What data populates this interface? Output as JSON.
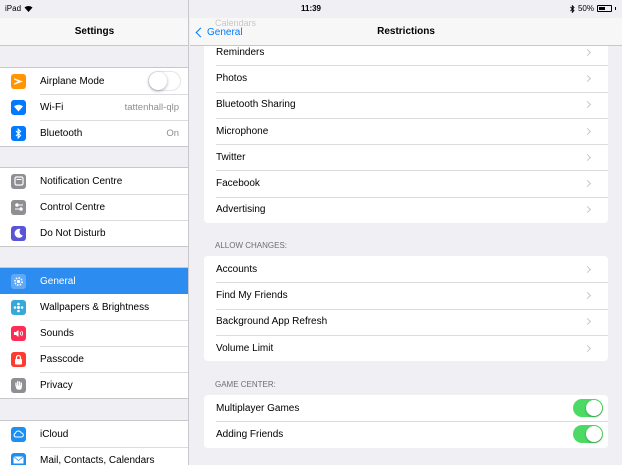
{
  "status_bar": {
    "device": "iPad",
    "wifi_icon": "wifi-icon",
    "time": "11:39",
    "bluetooth_icon": "bluetooth-icon",
    "battery": "50%"
  },
  "settings": {
    "title": "Settings",
    "groups": [
      [
        {
          "label": "Airplane Mode",
          "icon": "airplane-icon",
          "color": "#ff9500"
        },
        {
          "label": "Wi-Fi",
          "value": "tattenhall-qlp",
          "icon": "wifi-icon",
          "color": "#007aff"
        },
        {
          "label": "Bluetooth",
          "value": "On",
          "icon": "bluetooth-icon",
          "color": "#007aff"
        }
      ],
      [
        {
          "label": "Notification Centre",
          "icon": "notification-centre-icon",
          "color": "#8e8e93"
        },
        {
          "label": "Control Centre",
          "icon": "control-centre-icon",
          "color": "#8e8e93"
        },
        {
          "label": "Do Not Disturb",
          "icon": "moon-icon",
          "color": "#5856d6"
        }
      ],
      [
        {
          "label": "General",
          "icon": "gear-icon",
          "color": "#8e8e93",
          "selected": true
        },
        {
          "label": "Wallpapers & Brightness",
          "icon": "wallpaper-icon",
          "color": "#34aadc"
        },
        {
          "label": "Sounds",
          "icon": "speaker-icon",
          "color": "#ff2d55"
        },
        {
          "label": "Passcode",
          "icon": "lock-icon",
          "color": "#ff3b30"
        },
        {
          "label": "Privacy",
          "icon": "hand-icon",
          "color": "#8e8e93"
        }
      ],
      [
        {
          "label": "iCloud",
          "icon": "cloud-icon",
          "color": "#1b8ff2"
        },
        {
          "label": "Mail, Contacts, Calendars",
          "icon": "mail-icon",
          "color": "#1b8ff2"
        }
      ]
    ]
  },
  "restrictions": {
    "back_label": "General",
    "title": "Restrictions",
    "ghost_text": "Calendars",
    "privacy_items": [
      "Reminders",
      "Photos",
      "Bluetooth Sharing",
      "Microphone",
      "Twitter",
      "Facebook",
      "Advertising"
    ],
    "allow_changes_title": "ALLOW CHANGES:",
    "allow_changes_items": [
      "Accounts",
      "Find My Friends",
      "Background App Refresh",
      "Volume Limit"
    ],
    "game_center_title": "GAME CENTER:",
    "game_center_items": [
      {
        "label": "Multiplayer Games",
        "on": true
      },
      {
        "label": "Adding Friends",
        "on": true
      }
    ]
  }
}
